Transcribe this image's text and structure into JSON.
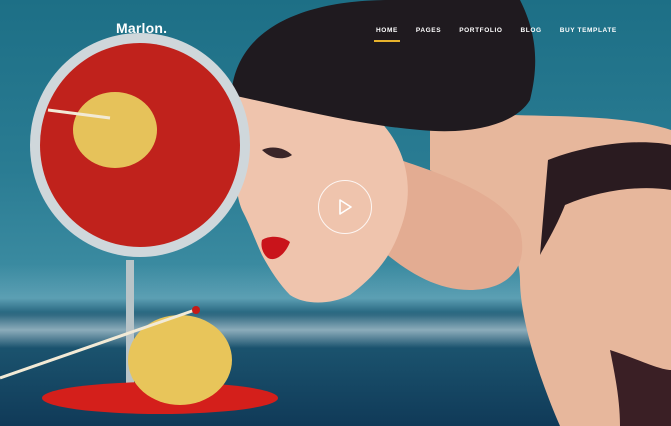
{
  "brand": {
    "logo": "Marlon."
  },
  "nav": {
    "items": [
      {
        "label": "HOME",
        "active": true
      },
      {
        "label": "PAGES",
        "active": false
      },
      {
        "label": "PORTFOLIO",
        "active": false
      },
      {
        "label": "BLOG",
        "active": false
      },
      {
        "label": "BUY TEMPLATE",
        "active": false
      }
    ],
    "active_color": "#e6b22c"
  },
  "hero": {
    "play_icon": "play-icon"
  }
}
